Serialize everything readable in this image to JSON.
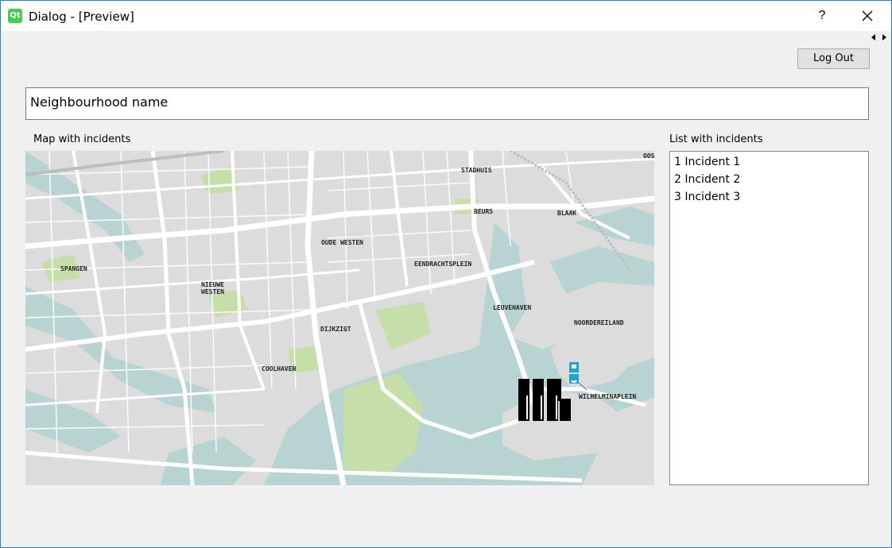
{
  "window": {
    "title": "Dialog - [Preview]",
    "icon_text": "Qt",
    "help_label": "?"
  },
  "toolbar": {
    "logout_label": "Log Out"
  },
  "neighbourhood": {
    "value": "Neighbourhood name"
  },
  "map": {
    "label": "Map with incidents",
    "places": [
      "STADHUIS",
      "BEURS",
      "BLAAK",
      "OUDE WESTEN",
      "EENDRACHTSPLEIN",
      "SPANGEN",
      "NIEUWE",
      "WESTEN",
      "LEUVEHAVEN",
      "NOORDEREILAND",
      "DIJKZIGT",
      "COOLHAVEN",
      "WILHELMINAPLEIN",
      "OOS"
    ],
    "colors": {
      "land": "#dcdcdc",
      "water": "#b8d4d2",
      "park": "#c6dfa8",
      "road": "#ffffff"
    }
  },
  "incidents": {
    "label": "List with incidents",
    "items": [
      "1 Incident 1",
      "2 Incident 2",
      "3 Incident 3"
    ]
  }
}
